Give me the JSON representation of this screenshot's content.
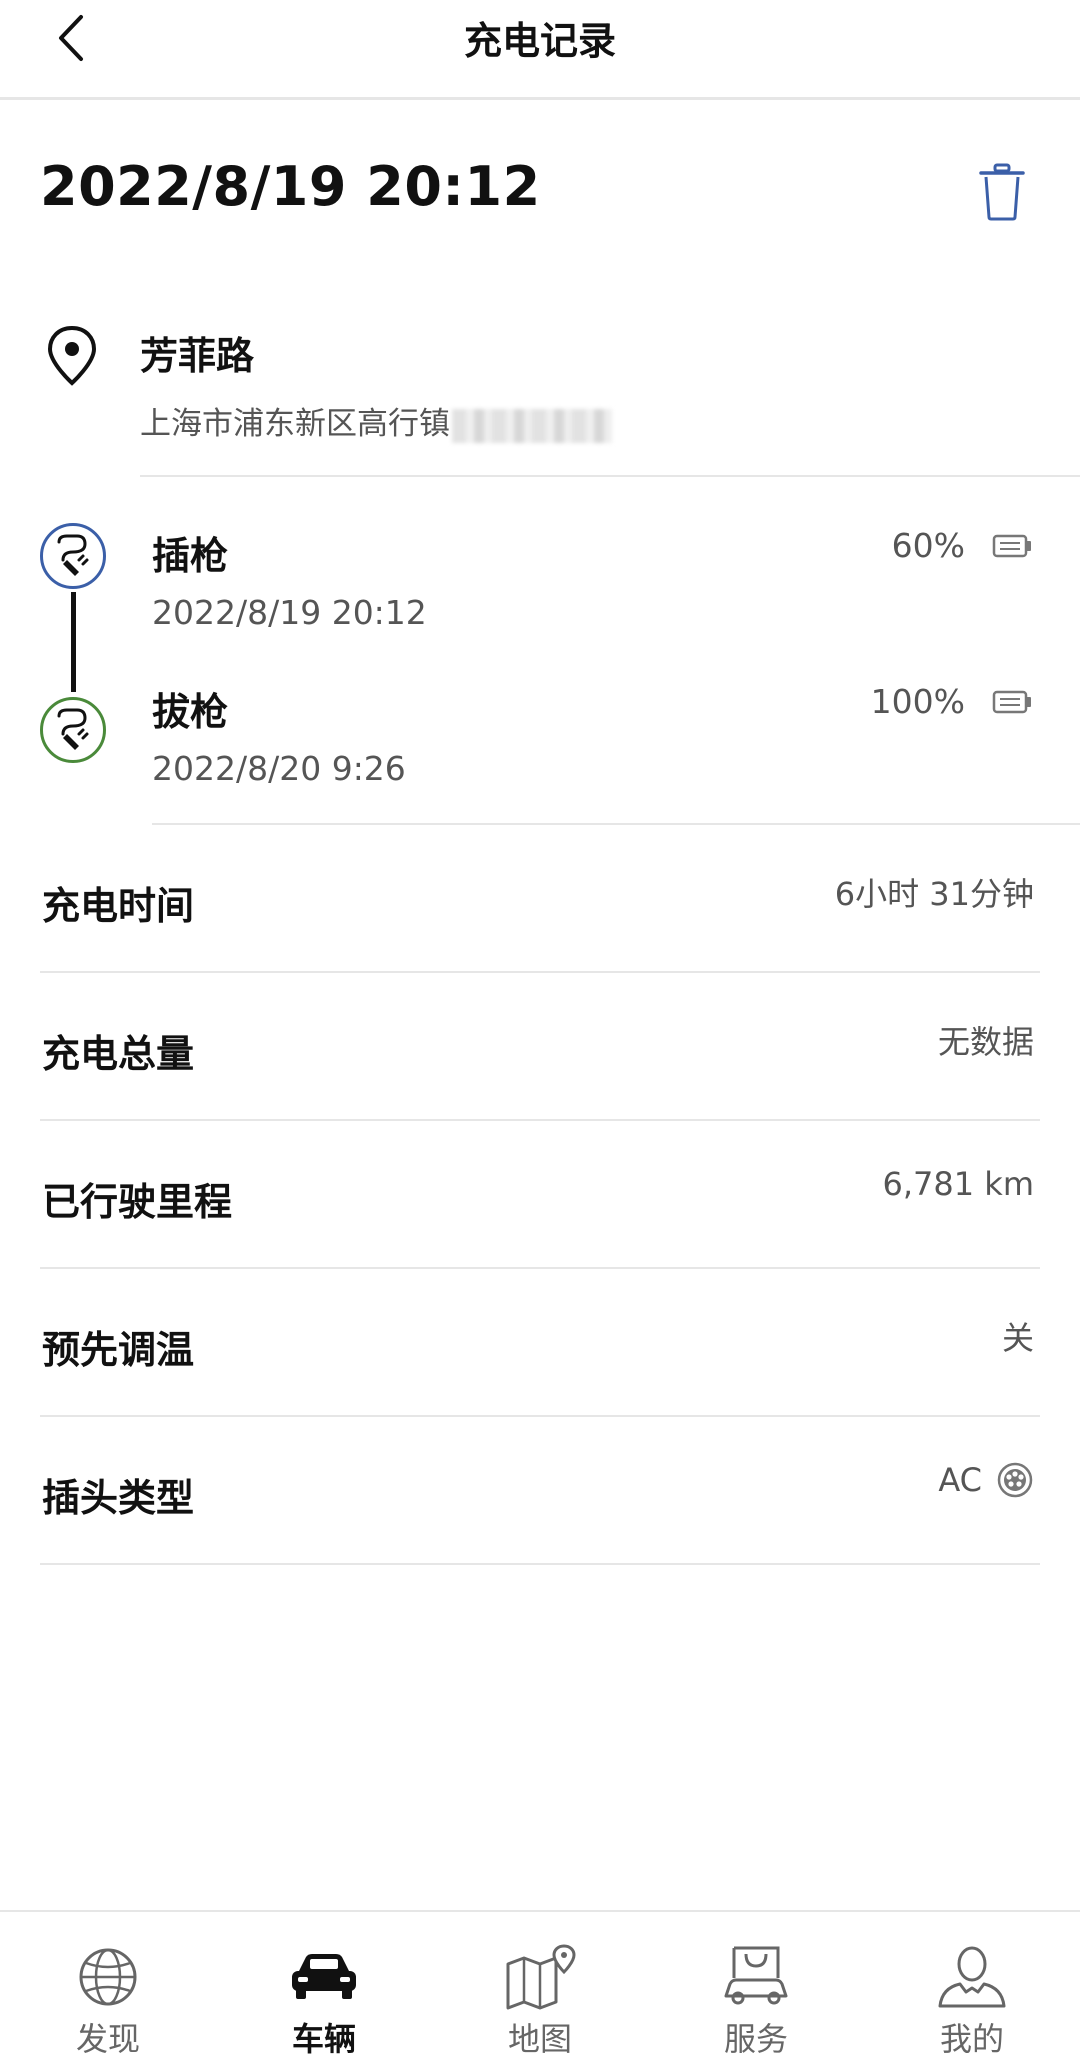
{
  "header": {
    "title": "充电记录"
  },
  "record": {
    "title": "2022/8/19 20:12"
  },
  "location": {
    "name": "芳菲路",
    "address": "上海市浦东新区高行镇"
  },
  "events": [
    {
      "label": "插枪",
      "time": "2022/8/19 20:12",
      "percent": "60%",
      "color": "#3b5fa8"
    },
    {
      "label": "拔枪",
      "time": "2022/8/20 9:26",
      "percent": "100%",
      "color": "#4a8a3a"
    }
  ],
  "details": [
    {
      "label": "充电时间",
      "value": "6小时 31分钟"
    },
    {
      "label": "充电总量",
      "value": "无数据"
    },
    {
      "label": "已行驶里程",
      "value": "6,781 km"
    },
    {
      "label": "预先调温",
      "value": "关"
    },
    {
      "label": "插头类型",
      "value": "AC"
    }
  ],
  "tabs": [
    {
      "label": "发现",
      "icon": "globe-icon",
      "active": false
    },
    {
      "label": "车辆",
      "icon": "car-icon",
      "active": true
    },
    {
      "label": "地图",
      "icon": "map-icon",
      "active": false
    },
    {
      "label": "服务",
      "icon": "service-bag-icon",
      "active": false
    },
    {
      "label": "我的",
      "icon": "person-icon",
      "active": false
    }
  ]
}
